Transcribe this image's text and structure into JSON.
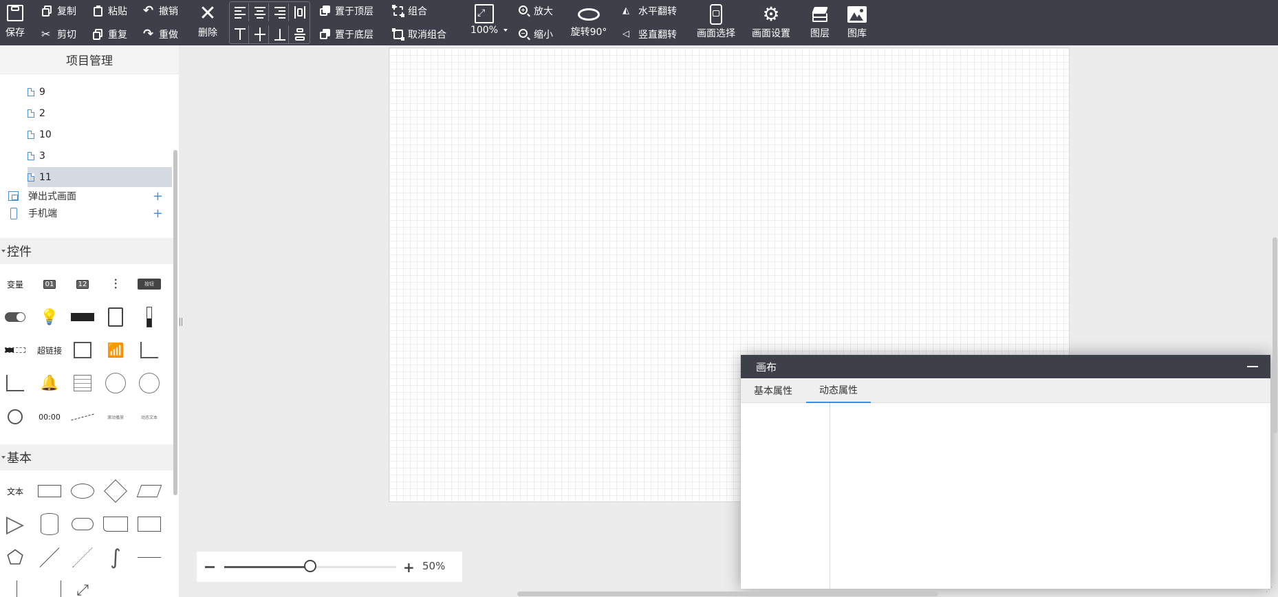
{
  "toolbar": {
    "save": "保存",
    "copy": "复制",
    "paste": "粘贴",
    "undo": "撤销",
    "cut": "剪切",
    "repeat": "重复",
    "redo": "重做",
    "delete": "删除",
    "bring_top": "置于顶层",
    "send_bottom": "置于底层",
    "group": "组合",
    "ungroup": "取消组合",
    "zoom_value": "100%",
    "zoom_in": "放大",
    "zoom_out": "缩小",
    "rotate": "旋转90°",
    "flip_h": "水平翻转",
    "flip_v": "竖直翻转",
    "screen_select": "画面选择",
    "screen_settings": "画面设置",
    "layers": "图层",
    "library": "图库"
  },
  "left": {
    "project_title": "项目管理",
    "tree_items": [
      {
        "label": "9"
      },
      {
        "label": "2"
      },
      {
        "label": "10"
      },
      {
        "label": "3"
      },
      {
        "label": "11",
        "selected": true
      }
    ],
    "groups": [
      {
        "label": "弹出式画面",
        "icon": "popup-screen-icon"
      },
      {
        "label": "手机端",
        "icon": "mobile-icon"
      }
    ],
    "controls_title": "控件",
    "controls": {
      "variable": "变量",
      "num1": "01",
      "num2": "12",
      "hyperlink": "超链接",
      "clock_text": "00:00",
      "small1": "滚动播放",
      "small2": "动态文本",
      "btn": "按钮"
    },
    "basic_title": "基本",
    "basic": {
      "text": "文本"
    }
  },
  "zoom": {
    "value_label": "50%",
    "level": 0.5
  },
  "panel": {
    "title": "画布",
    "tabs": [
      {
        "label": "基本属性",
        "active": false
      },
      {
        "label": "动态属性",
        "active": true
      }
    ]
  },
  "colors": {
    "toolbar_bg": "#3d4049",
    "accent": "#3a8ee6",
    "tree_icon": "#4a90d9"
  }
}
